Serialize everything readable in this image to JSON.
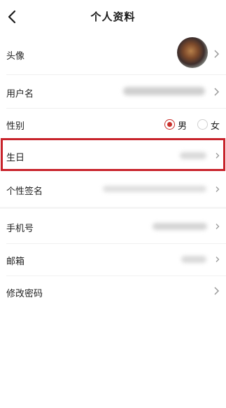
{
  "header": {
    "title": "个人资料",
    "back_icon": "chevron-left-icon"
  },
  "rows": {
    "avatar": {
      "label": "头像"
    },
    "username": {
      "label": "用户名"
    },
    "gender": {
      "label": "性别",
      "options": [
        "男",
        "女"
      ],
      "selected": "男"
    },
    "birthday": {
      "label": "生日"
    },
    "signature": {
      "label": "个性签名"
    },
    "phone": {
      "label": "手机号"
    },
    "email": {
      "label": "邮箱"
    },
    "password": {
      "label": "修改密码"
    }
  },
  "colors": {
    "accent": "#c9302c",
    "highlight_border": "#c8232b"
  }
}
